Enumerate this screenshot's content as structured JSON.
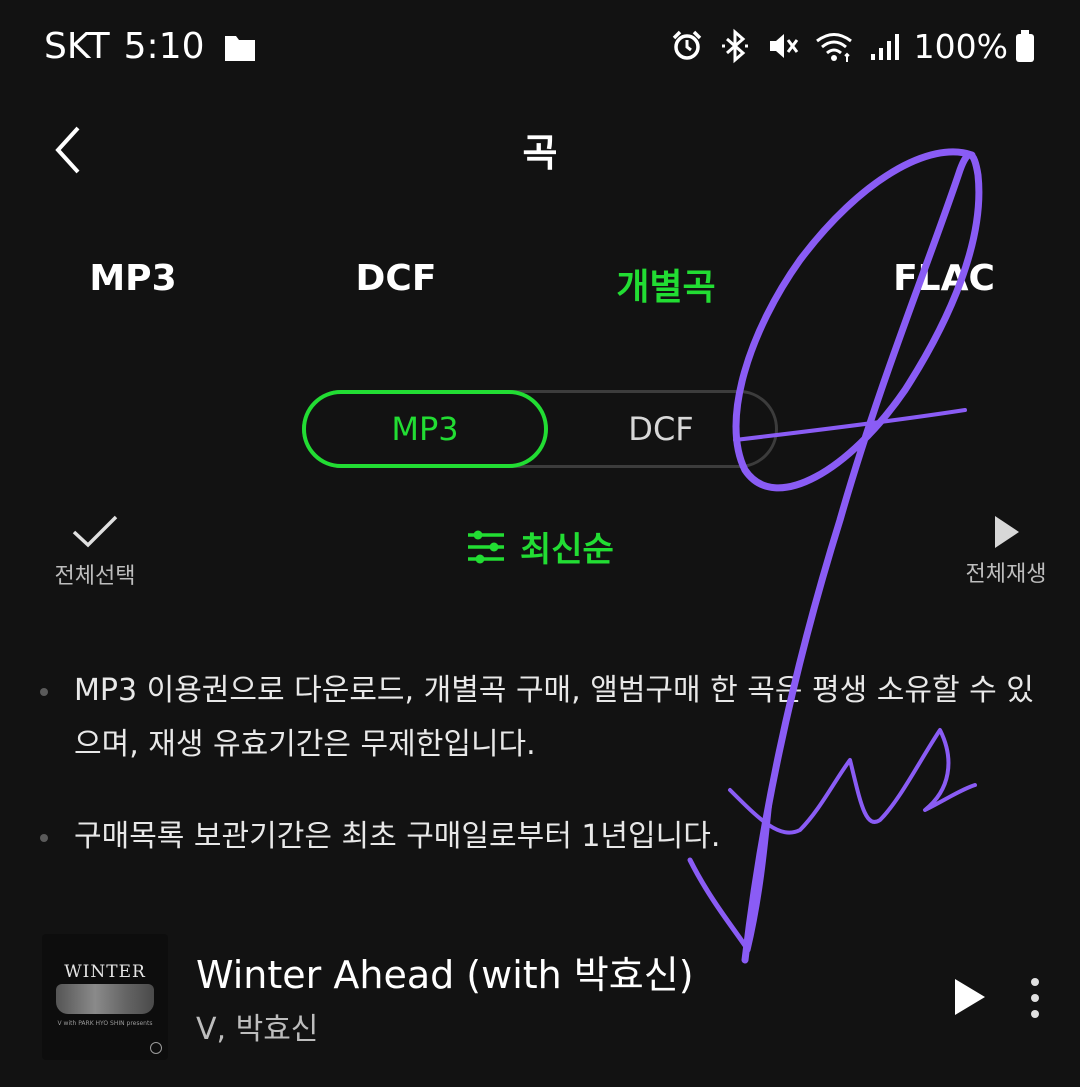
{
  "status_bar": {
    "carrier": "SKT",
    "time": "5:10",
    "battery": "100%",
    "icons": [
      "folder-icon",
      "alarm-icon",
      "bluetooth-icon",
      "mute-icon",
      "wifi-icon",
      "signal-icon",
      "battery-icon"
    ]
  },
  "header": {
    "title": "곡"
  },
  "tabs": [
    {
      "label": "MP3",
      "active": false
    },
    {
      "label": "DCF",
      "active": false
    },
    {
      "label": "개별곡",
      "active": true
    },
    {
      "label": "FLAC",
      "active": false
    }
  ],
  "segment": {
    "options": [
      "MP3",
      "DCF"
    ],
    "selected": "MP3"
  },
  "actions": {
    "select_all": "전체선택",
    "sort": "최신순",
    "play_all": "전체재생"
  },
  "notices": [
    "MP3 이용권으로 다운로드, 개별곡 구매, 앨범구매 한 곡은 평생 소유할 수 있으며, 재생 유효기간은 무제한입니다.",
    "구매목록 보관기간은 최초 구매일로부터 1년입니다."
  ],
  "songs": [
    {
      "title": "Winter Ahead (with 박효신)",
      "artist": "V, 박효신",
      "album_art_text": "WINTER AHEAD",
      "album_art_credit": "V with PARK HYO SHIN presents"
    }
  ],
  "colors": {
    "background": "#121212",
    "accent": "#22dd33",
    "signature": "#8a5cf5"
  }
}
